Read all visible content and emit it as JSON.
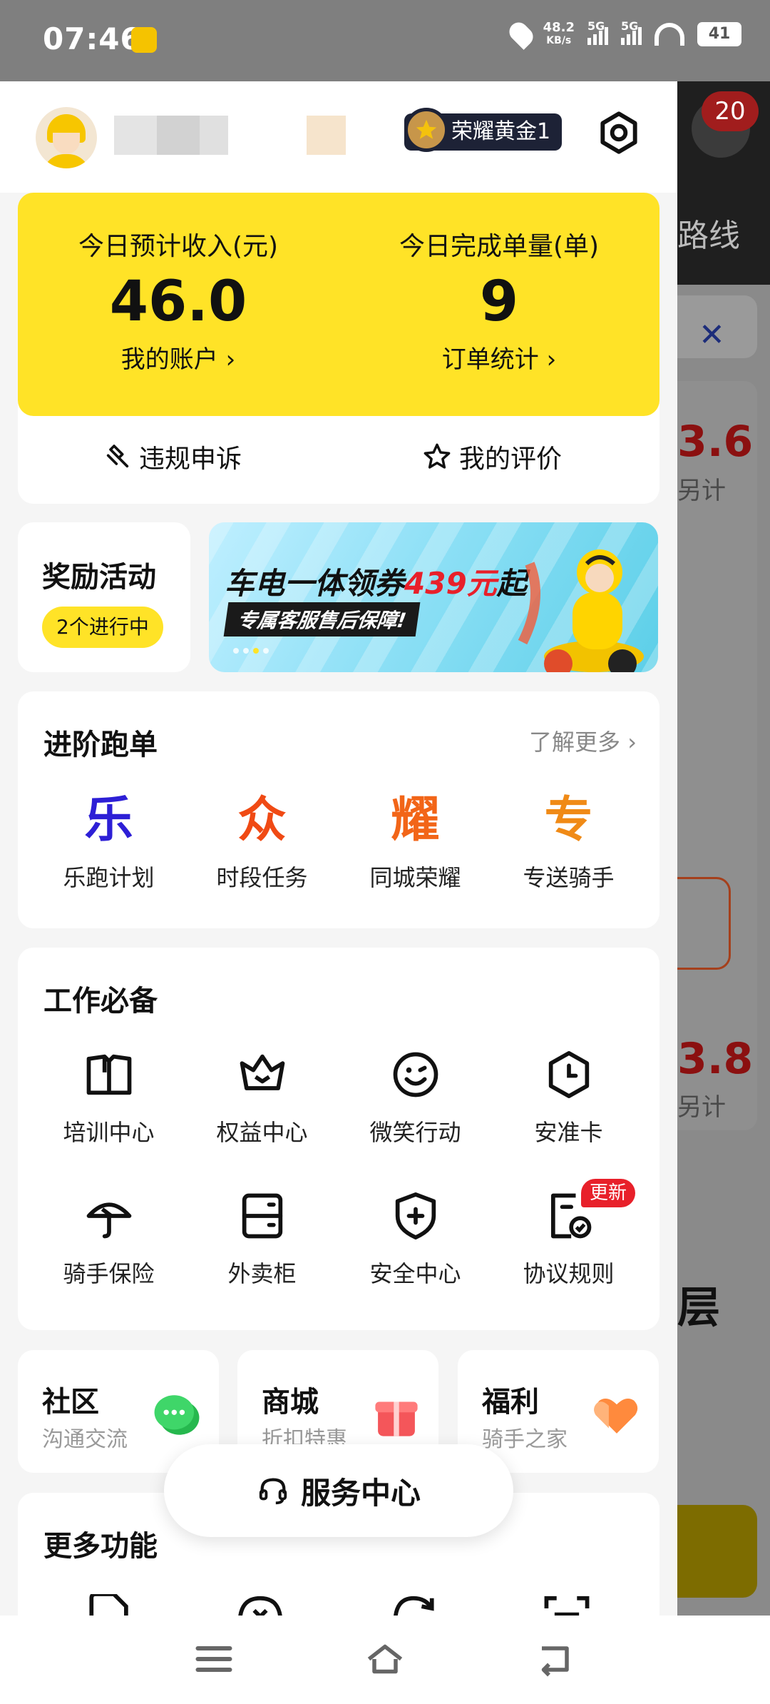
{
  "status_bar": {
    "time": "07:46",
    "net_speed": "48.2",
    "net_unit": "KB/s",
    "sig1": "5G",
    "sig2": "5G",
    "battery": "41"
  },
  "background": {
    "notification_count": "20",
    "route_label": "路线",
    "red_value_1": "3.6",
    "sub_text_1": "另计",
    "red_value_2": "3.8",
    "sub_text_2": "另计",
    "floor_text": "层"
  },
  "profile": {
    "rank_badge": "荣耀黄金1"
  },
  "income": {
    "left_label": "今日预计收入(元)",
    "left_value": "46.0",
    "left_link": "我的账户 ›",
    "right_label": "今日完成单量(单)",
    "right_value": "9",
    "right_link": "订单统计 ›"
  },
  "actions": {
    "appeal": "违规申诉",
    "rating": "我的评价"
  },
  "rewards": {
    "title": "奖励活动",
    "pill": "2个进行中",
    "banner_head": "车电一体领券",
    "banner_amount": "439元",
    "banner_tail": "起",
    "banner_sub": "专属客服售后保障!"
  },
  "advanced": {
    "title": "进阶跑单",
    "more": "了解更多 ›",
    "items": [
      {
        "glyph": "乐",
        "label": "乐跑计划",
        "color": "#2d1fd6"
      },
      {
        "glyph": "众",
        "label": "时段任务",
        "color": "#f04a14"
      },
      {
        "glyph": "耀",
        "label": "同城荣耀",
        "color": "#f26518"
      },
      {
        "glyph": "专",
        "label": "专送骑手",
        "color": "#f08a16"
      }
    ]
  },
  "essentials": {
    "title": "工作必备",
    "items": [
      {
        "label": "培训中心",
        "icon": "book-icon"
      },
      {
        "label": "权益中心",
        "icon": "crown-icon"
      },
      {
        "label": "微笑行动",
        "icon": "smile-icon"
      },
      {
        "label": "安准卡",
        "icon": "clock-icon"
      },
      {
        "label": "骑手保险",
        "icon": "umbrella-icon"
      },
      {
        "label": "外卖柜",
        "icon": "locker-icon"
      },
      {
        "label": "安全中心",
        "icon": "shield-icon"
      },
      {
        "label": "协议规则",
        "icon": "agreement-icon",
        "badge": "更新"
      }
    ]
  },
  "tiles": [
    {
      "title": "社区",
      "subtitle": "沟通交流"
    },
    {
      "title": "商城",
      "subtitle": "折扣特惠"
    },
    {
      "title": "福利",
      "subtitle": "骑手之家"
    }
  ],
  "service_center": "服务中心",
  "more_features": {
    "title": "更多功能"
  }
}
